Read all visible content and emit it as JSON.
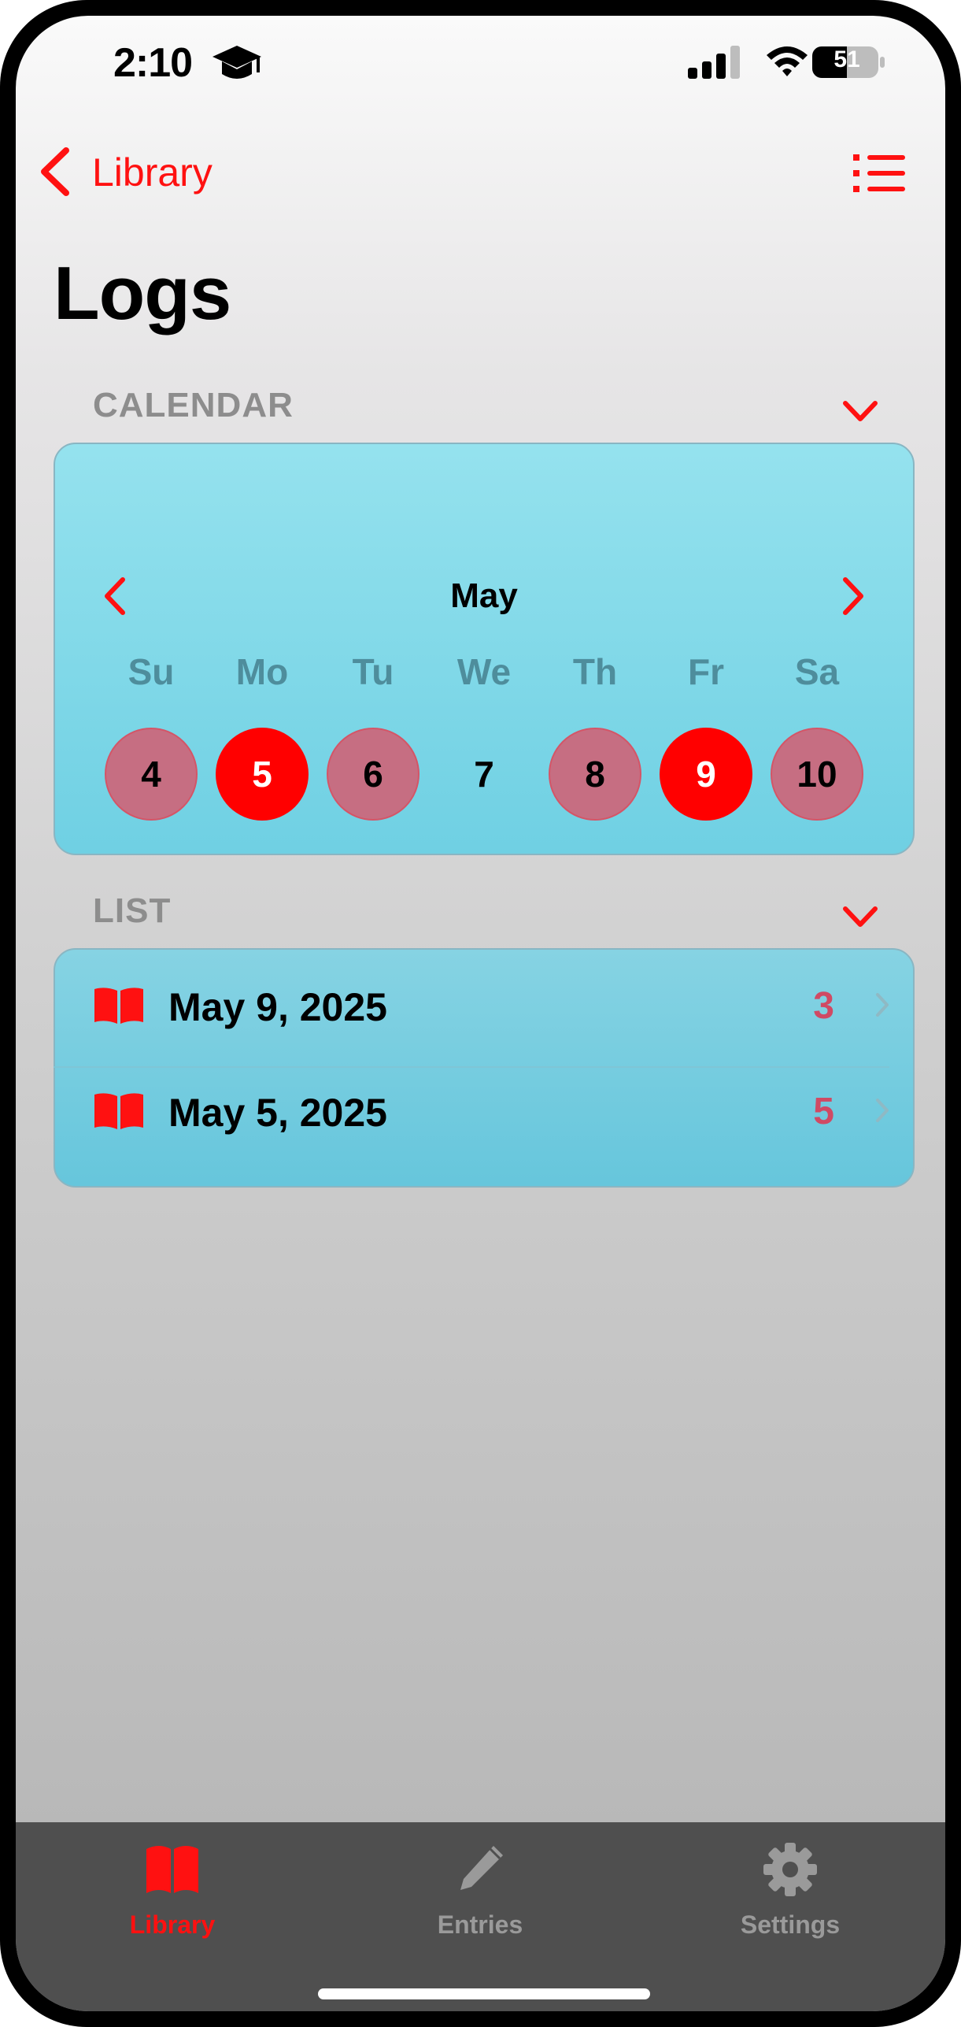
{
  "status_bar": {
    "time": "2:10",
    "battery": "51"
  },
  "nav": {
    "back_label": "Library"
  },
  "page": {
    "title": "Logs"
  },
  "calendar": {
    "section_label": "CALENDAR",
    "month": "May",
    "weekdays": [
      "Su",
      "Mo",
      "Tu",
      "We",
      "Th",
      "Fr",
      "Sa"
    ],
    "days": [
      {
        "label": "4",
        "state": "logged"
      },
      {
        "label": "5",
        "state": "active"
      },
      {
        "label": "6",
        "state": "logged"
      },
      {
        "label": "7",
        "state": "empty"
      },
      {
        "label": "8",
        "state": "logged"
      },
      {
        "label": "9",
        "state": "active"
      },
      {
        "label": "10",
        "state": "logged"
      }
    ]
  },
  "list": {
    "section_label": "LIST",
    "items": [
      {
        "date": "May 9, 2025",
        "count": "3"
      },
      {
        "date": "May 5, 2025",
        "count": "5"
      }
    ]
  },
  "tabs": [
    {
      "label": "Library",
      "icon": "book-icon",
      "selected": true
    },
    {
      "label": "Entries",
      "icon": "pencil-icon",
      "selected": false
    },
    {
      "label": "Settings",
      "icon": "gear-icon",
      "selected": false
    }
  ],
  "colors": {
    "accent": "#ff1111",
    "card": "#7fd6e8",
    "tab_bar": "#4f4f4f",
    "inactive_tab": "#9a9a9a",
    "count": "#d04a64"
  }
}
